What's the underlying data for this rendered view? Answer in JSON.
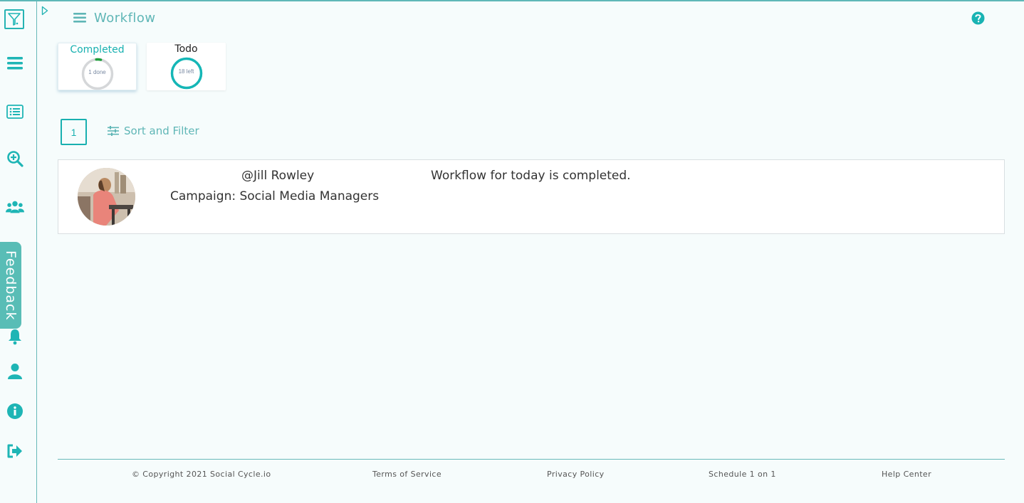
{
  "header": {
    "title": "Workflow"
  },
  "sidebar": {
    "feedback_label": "Feedback",
    "icons": [
      "filter-logo-icon",
      "menu-icon",
      "list-icon",
      "search-zoom-icon",
      "users-icon",
      "bell-icon",
      "user-icon",
      "info-icon",
      "logout-icon"
    ]
  },
  "stats": {
    "completed": {
      "label": "Completed",
      "value_text": "1 done",
      "progress": 0.05
    },
    "todo": {
      "label": "Todo",
      "value_text": "18 left",
      "progress": 1.0
    }
  },
  "pagination": {
    "current_page": "1"
  },
  "sort_filter": {
    "label": "Sort and Filter"
  },
  "items": [
    {
      "handle": "@Jill Rowley",
      "campaign": "Campaign: Social Media Managers",
      "status": "Workflow for today is completed."
    }
  ],
  "footer": {
    "copyright": "© Copyright 2021 Social Cycle.io",
    "terms": "Terms of Service",
    "privacy": "Privacy Policy",
    "schedule": "Schedule 1 on 1",
    "help": "Help Center"
  },
  "colors": {
    "accent": "#19b0b0",
    "sidebar_icon": "#1eb5b5",
    "feedback_bg": "#59bdb6",
    "progress_green": "#1e9e3a"
  }
}
